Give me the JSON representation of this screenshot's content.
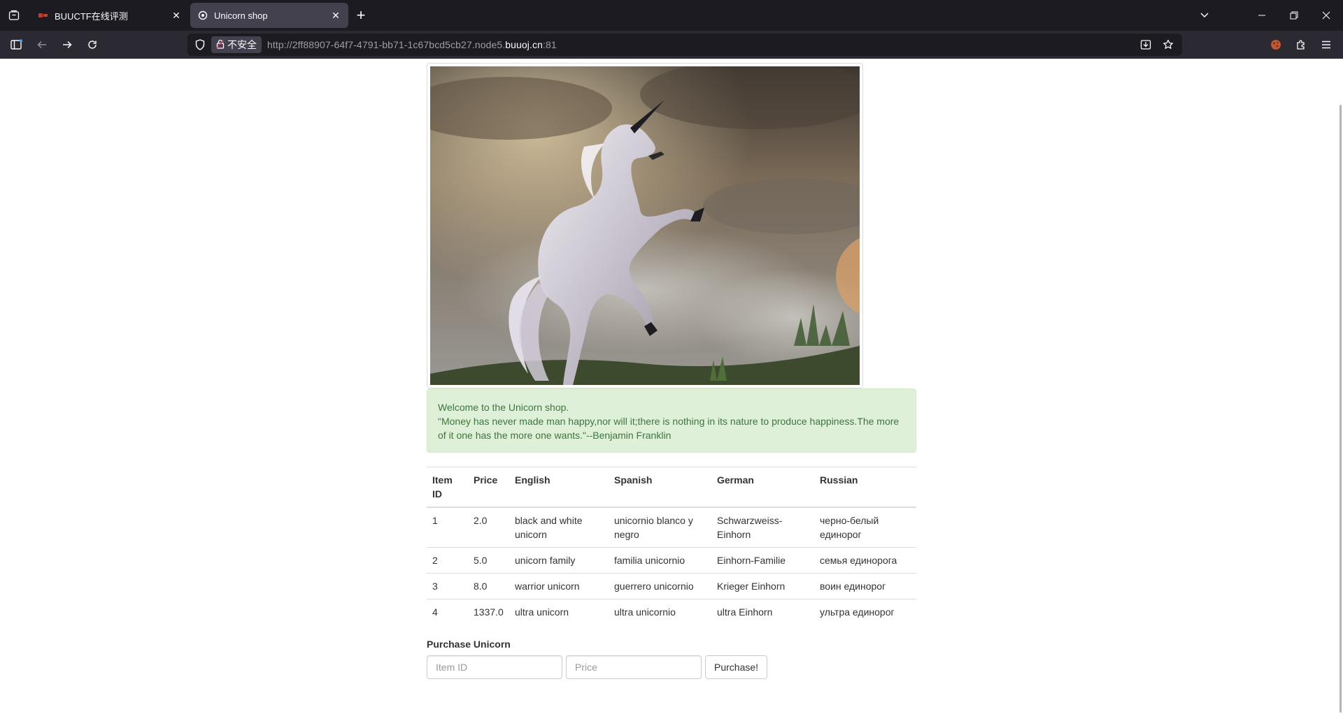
{
  "browser": {
    "tabs": [
      {
        "title": "BUUCTF在线评测",
        "active": false
      },
      {
        "title": "Unicorn shop",
        "active": true
      }
    ],
    "security_label": "不安全",
    "url_prefix": "http://2ff88907-64f7-4791-bb71-1c67bcd5cb27.node5.",
    "url_domain": "buuoj.cn",
    "url_suffix": ":81",
    "colors": {
      "chrome_bg": "#1c1b22",
      "toolbar_bg": "#2b2a33",
      "active_tab": "#42414d"
    }
  },
  "page": {
    "image_alt": "Unicorn",
    "welcome": {
      "line1": "Welcome to the Unicorn shop.",
      "line2": "\"Money has never made man happy,nor will it;there is nothing in its nature to produce happiness.The more of it one has the more one wants.\"--Benjamin Franklin"
    },
    "table": {
      "headers": [
        "Item ID",
        "Price",
        "English",
        "Spanish",
        "German",
        "Russian"
      ],
      "rows": [
        [
          "1",
          "2.0",
          "black and white unicorn",
          "unicornio blanco y negro",
          "Schwarzweiss-Einhorn",
          "черно-белый единорог"
        ],
        [
          "2",
          "5.0",
          "unicorn family",
          "familia unicornio",
          "Einhorn-Familie",
          "семья единорога"
        ],
        [
          "3",
          "8.0",
          "warrior unicorn",
          "guerrero unicornio",
          "Krieger Einhorn",
          "воин единорог"
        ],
        [
          "4",
          "1337.0",
          "ultra unicorn",
          "ultra unicornio",
          "ultra Einhorn",
          "ультра единорог"
        ]
      ]
    },
    "purchase": {
      "title": "Purchase Unicorn",
      "item_id_placeholder": "Item ID",
      "price_placeholder": "Price",
      "button_label": "Purchase!"
    },
    "colors": {
      "alert_bg": "#dff0d8",
      "alert_text": "#3c763d",
      "table_border": "#dddddd"
    }
  }
}
